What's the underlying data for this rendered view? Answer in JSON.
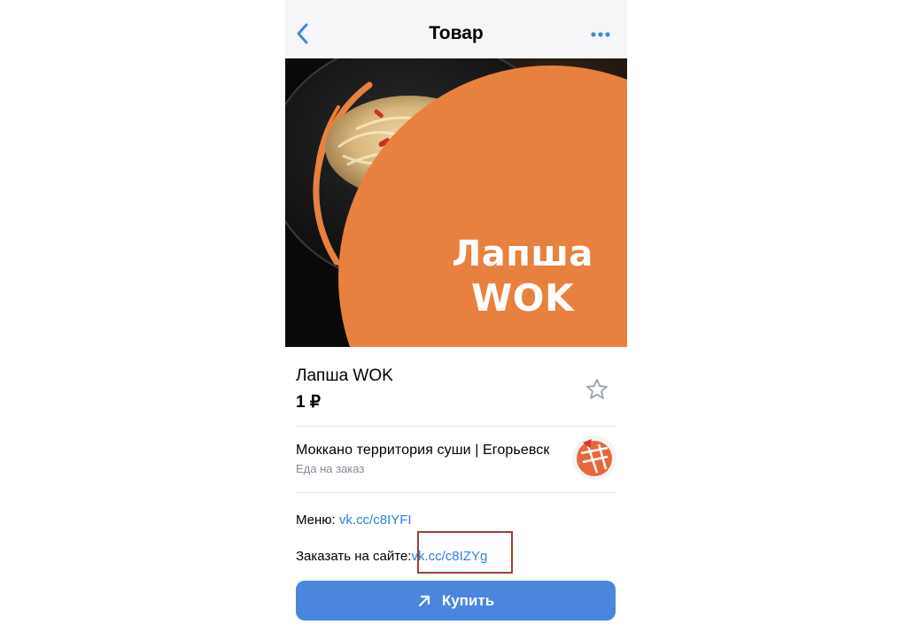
{
  "navbar": {
    "title": "Товар",
    "back_icon": "chevron-left-icon",
    "more_icon": "more-horizontal-icon"
  },
  "hero": {
    "line1": "Лапша",
    "line2": "WOK"
  },
  "product": {
    "name": "Лапша WOK",
    "price": "1 ₽",
    "favorite_icon": "star-outline-icon"
  },
  "shop": {
    "name": "Моккано территория суши | Егорьевск",
    "subtitle": "Еда на заказ"
  },
  "info": {
    "menu_label": "Меню:",
    "menu_link": "vk.cc/c8IYFI",
    "order_label": "Заказать на сайте:",
    "order_link": "vk.cc/c8IZYg"
  },
  "buy_button": {
    "label": "Купить",
    "icon": "arrow-up-right-icon"
  },
  "colors": {
    "accent": "#4a86e0",
    "link": "#2d81e0",
    "orange": "#e8813f",
    "highlight": "#a33f36"
  }
}
